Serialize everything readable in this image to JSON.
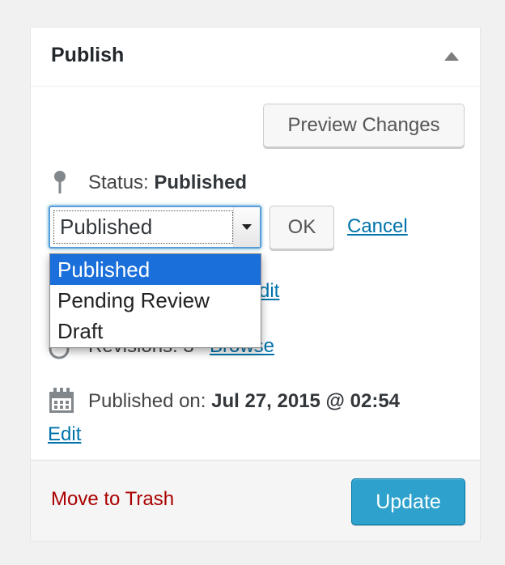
{
  "panel": {
    "title": "Publish",
    "preview_label": "Preview Changes",
    "status": {
      "label": "Status:",
      "value": "Published",
      "select_value": "Published",
      "ok_label": "OK",
      "cancel_label": "Cancel",
      "options": [
        "Published",
        "Pending Review",
        "Draft"
      ]
    },
    "visibility": {
      "edit_fragment": "dit"
    },
    "revisions": {
      "label": "Revisions: 3",
      "browse_label": "Browse"
    },
    "published_on": {
      "label": "Published on:",
      "value": "Jul 27, 2015 @ 02:54",
      "edit_label": "Edit"
    },
    "footer": {
      "trash_label": "Move to Trash",
      "update_label": "Update"
    }
  },
  "colors": {
    "link": "#0073aa",
    "trash": "#aa0000",
    "primary": "#2ea2cc",
    "selected_option": "#1a6fdb"
  }
}
